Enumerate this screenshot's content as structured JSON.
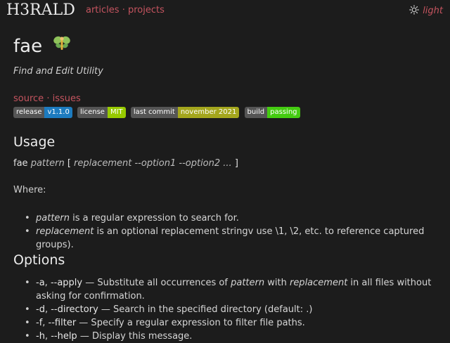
{
  "header": {
    "logo": "H3RALD",
    "nav": [
      {
        "label": "articles"
      },
      {
        "label": "projects"
      }
    ],
    "separator": "·",
    "theme_toggle": "light"
  },
  "page": {
    "title": "fae",
    "subtitle": "Find and Edit Utility",
    "links": [
      {
        "label": "source"
      },
      {
        "label": "issues"
      }
    ],
    "badges": [
      {
        "key": "release",
        "value": "v1.1.0",
        "color": "#1d7bbf"
      },
      {
        "key": "license",
        "value": "MIT",
        "color": "#97ca00"
      },
      {
        "key": "last commit",
        "value": "november 2021",
        "color": "#a4a61d"
      },
      {
        "key": "build",
        "value": "passing",
        "color": "#44cc11"
      }
    ]
  },
  "usage": {
    "heading": "Usage",
    "command": "fae",
    "pattern": "pattern",
    "open_bracket": "[",
    "optional": "replacement --option1 --option2 ...",
    "close_bracket": "]",
    "where": "Where:",
    "items": [
      {
        "term": "pattern",
        "text": " is a regular expression to search for."
      },
      {
        "term": "replacement",
        "text": " is an optional replacement stringv use \\1, \\2, etc. to reference captured groups)."
      }
    ]
  },
  "options": {
    "heading": "Options",
    "items": [
      {
        "short": "-a",
        "long": "--apply",
        "pre": " — Substitute all occurrences of ",
        "em1": "pattern",
        "mid": " with ",
        "em2": "replacement",
        "post": " in all files without asking for confirmation."
      },
      {
        "short": "-d",
        "long": "--directory",
        "desc": " — Search in the specified directory (default: .)"
      },
      {
        "short": "-f",
        "long": "--filter",
        "desc": " — Specify a regular expression to filter file paths."
      },
      {
        "short": "-h",
        "long": "--help",
        "desc": " — Display this message."
      }
    ]
  }
}
